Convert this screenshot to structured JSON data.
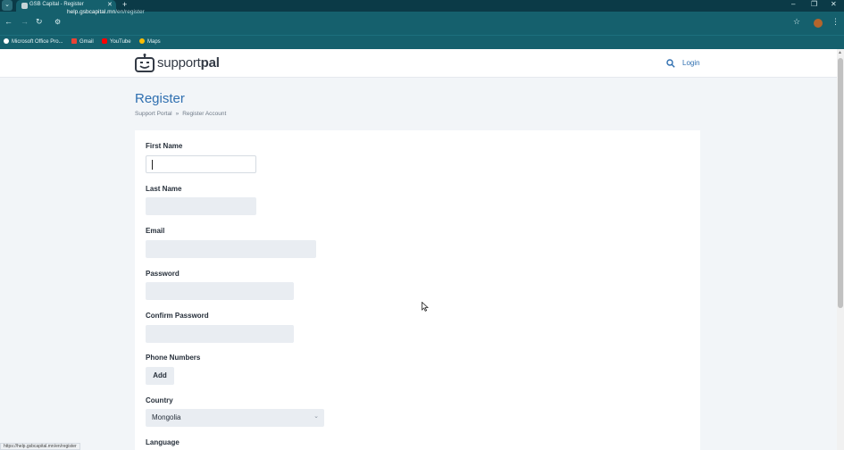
{
  "browser": {
    "tab_title": "GSB Capital - Register",
    "url_host": "help.gsbcapital.mn",
    "url_path": "/en/register",
    "bookmarks": [
      {
        "label": "Microsoft Office Pro...",
        "icon": "microsoft-office-icon",
        "color": "#ffffff"
      },
      {
        "label": "Gmail",
        "icon": "gmail-icon",
        "color": "#ea4335"
      },
      {
        "label": "YouTube",
        "icon": "youtube-icon",
        "color": "#ff0000"
      },
      {
        "label": "Maps",
        "icon": "maps-icon",
        "color": "#fbbc04"
      }
    ],
    "status_url": "https://help.gsbcapital.mn/en/register"
  },
  "header": {
    "logo_text_a": "support",
    "logo_text_b": "pal",
    "login_label": "Login"
  },
  "page": {
    "title": "Register",
    "breadcrumb": [
      "Support Portal",
      "Register Account"
    ],
    "breadcrumb_sep": "»"
  },
  "form": {
    "first_name_label": "First Name",
    "last_name_label": "Last Name",
    "email_label": "Email",
    "password_label": "Password",
    "confirm_password_label": "Confirm Password",
    "phone_numbers_label": "Phone Numbers",
    "add_label": "Add",
    "country_label": "Country",
    "country_value": "Mongolia",
    "language_label": "Language"
  },
  "colors": {
    "browser_frame": "#15606d",
    "accent": "#2f6fb0",
    "input_bg": "#e9edf2"
  }
}
